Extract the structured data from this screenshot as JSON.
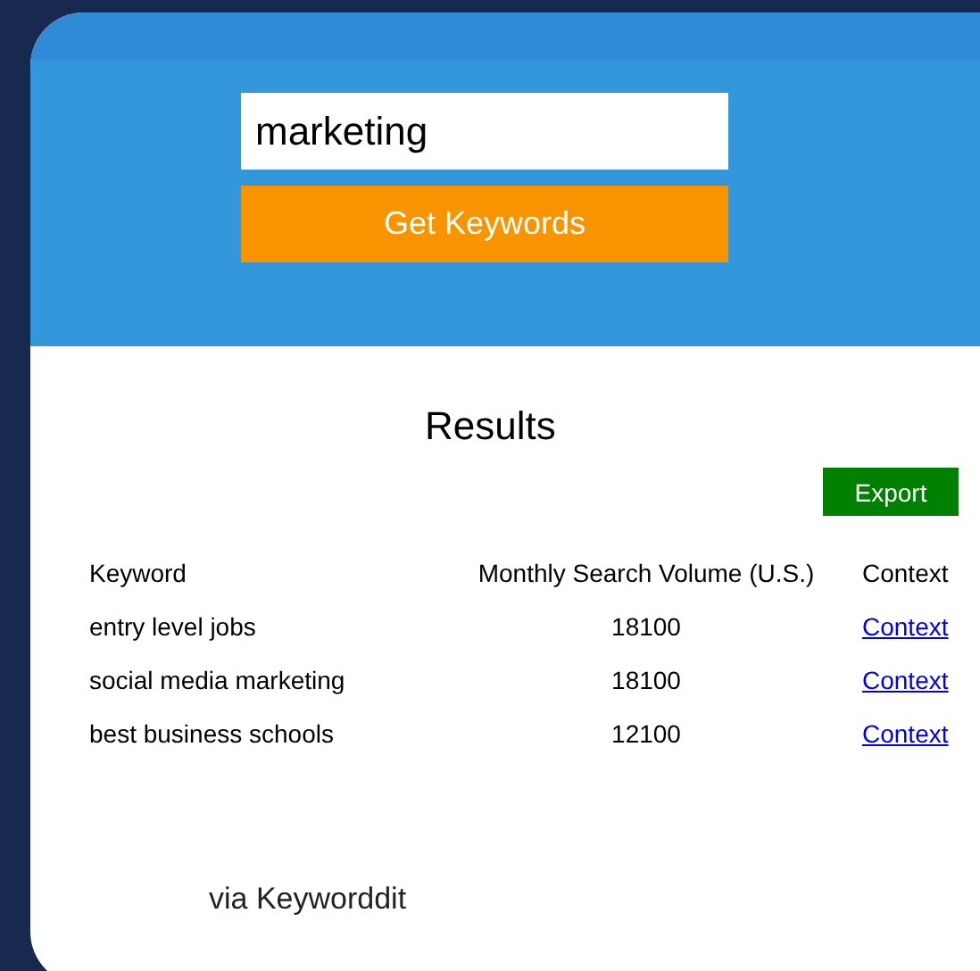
{
  "search": {
    "value": "marketing"
  },
  "submit_button": "Get Keywords",
  "results": {
    "title": "Results",
    "export_button": "Export",
    "columns": [
      "Keyword",
      "Monthly Search Volume (U.S.)",
      "Context"
    ],
    "rows": [
      {
        "keyword": "entry level jobs",
        "volume": "18100",
        "context": "Context"
      },
      {
        "keyword": "social media marketing",
        "volume": "18100",
        "context": "Context"
      },
      {
        "keyword": "best business schools",
        "volume": "12100",
        "context": "Context"
      }
    ]
  },
  "footer": "via Keyworddit"
}
